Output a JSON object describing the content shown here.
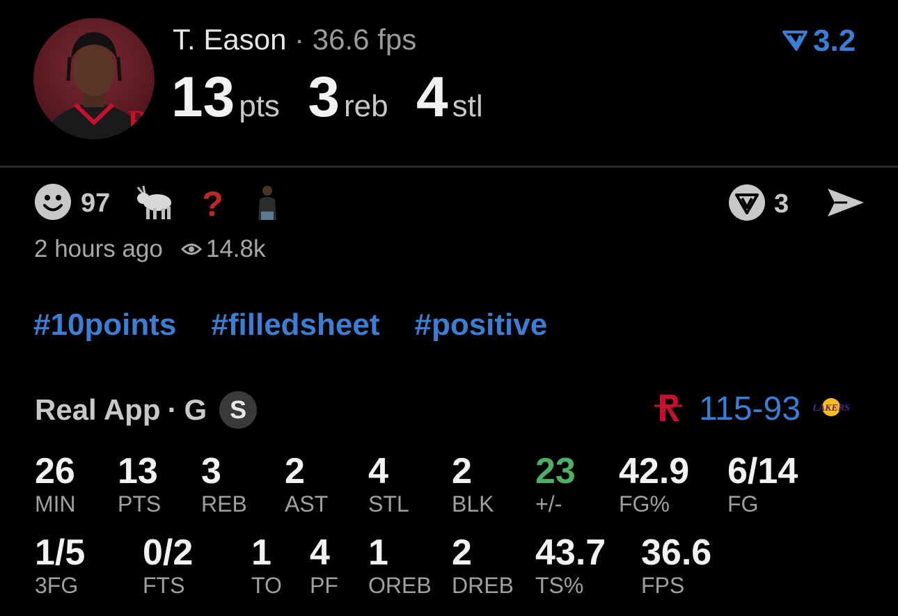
{
  "header": {
    "player_name": "T. Eason",
    "separator": "·",
    "fps_label": "36.6 fps",
    "pts_value": "13",
    "pts_unit": "pts",
    "reb_value": "3",
    "reb_unit": "reb",
    "stl_value": "4",
    "stl_unit": "stl",
    "rating_value": "3.2",
    "rating_icon": "fantasy-rating-icon",
    "avatar_icon": "player-avatar"
  },
  "reactions": {
    "smile_count": "97",
    "icons": [
      "smile-icon",
      "goat-icon",
      "question-icon",
      "person-sticker-icon"
    ],
    "time_ago": "2 hours ago",
    "views": "14.8k",
    "comment_count": "3"
  },
  "hashtags": [
    "#10points",
    "#filledsheet",
    "#positive"
  ],
  "game": {
    "source": "Real App",
    "separator": "·",
    "position": "G",
    "badge": "S",
    "home_score": "115",
    "dash": "-",
    "away_score": "93",
    "home_team_icon": "rockets-logo",
    "away_team_icon": "lakers-logo"
  },
  "stats_row1": [
    {
      "value": "26",
      "label": "MIN"
    },
    {
      "value": "13",
      "label": "PTS"
    },
    {
      "value": "3",
      "label": "REB"
    },
    {
      "value": "2",
      "label": "AST"
    },
    {
      "value": "4",
      "label": "STL"
    },
    {
      "value": "2",
      "label": "BLK"
    },
    {
      "value": "23",
      "label": "+/-"
    },
    {
      "value": "42.9",
      "label": "FG%"
    },
    {
      "value": "6/14",
      "label": "FG"
    }
  ],
  "stats_row2": [
    {
      "value": "1/5",
      "label": "3FG"
    },
    {
      "value": "0/2",
      "label": "FTS"
    },
    {
      "value": "1",
      "label": "TO"
    },
    {
      "value": "4",
      "label": "PF"
    },
    {
      "value": "1",
      "label": "OREB"
    },
    {
      "value": "2",
      "label": "DREB"
    },
    {
      "value": "43.7",
      "label": "TS%"
    },
    {
      "value": "36.6",
      "label": "FPS"
    }
  ],
  "colors": {
    "accent_blue": "#3a7fd5",
    "positive_green": "#4caf63",
    "background": "#000000"
  }
}
